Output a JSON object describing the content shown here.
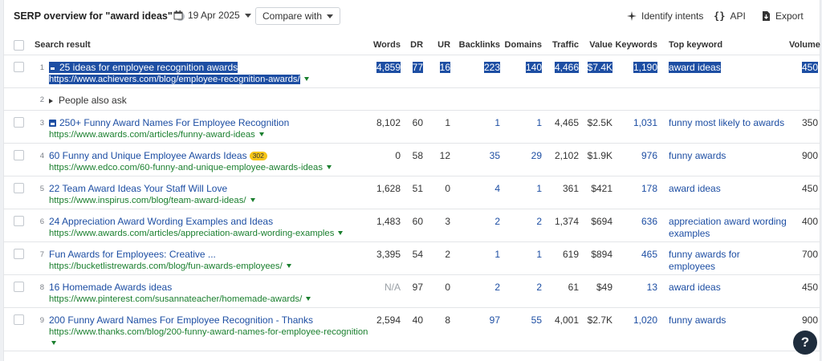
{
  "header": {
    "title": "SERP overview for \"award ideas\"",
    "help_icon": "question-icon",
    "date": "19 Apr 2025",
    "compare_label": "Compare with",
    "identify_label": "Identify intents",
    "api_label": "API",
    "export_label": "Export"
  },
  "columns": {
    "search_result": "Search result",
    "words": "Words",
    "dr": "DR",
    "ur": "UR",
    "backlinks": "Backlinks",
    "domains": "Domains",
    "traffic": "Traffic",
    "value": "Value",
    "keywords": "Keywords",
    "top_keyword": "Top keyword",
    "volume": "Volume"
  },
  "rows": [
    {
      "num": "1",
      "title": "25 ideas for employee recognition awards",
      "url": "https://www.achievers.com/blog/employee-recognition-awards/",
      "words": "4,859",
      "dr": "77",
      "ur": "16",
      "backlinks": "223",
      "domains": "140",
      "traffic": "4,466",
      "value": "$7.4K",
      "keywords": "1,190",
      "top_keyword": "award ideas",
      "volume": "450"
    },
    {
      "num": "2",
      "paa": "People also ask"
    },
    {
      "num": "3",
      "title": "250+ Funny Award Names For Employee Recognition",
      "url": "https://www.awards.com/articles/funny-award-ideas",
      "words": "8,102",
      "dr": "60",
      "ur": "1",
      "backlinks": "1",
      "domains": "1",
      "traffic": "4,465",
      "value": "$2.5K",
      "keywords": "1,031",
      "top_keyword": "funny most likely to awards",
      "volume": "350"
    },
    {
      "num": "4",
      "title": "60 Funny and Unique Employee Awards Ideas",
      "badge": "302",
      "url": "https://www.edco.com/60-funny-and-unique-employee-awards-ideas",
      "words": "0",
      "dr": "58",
      "ur": "12",
      "backlinks": "35",
      "domains": "29",
      "traffic": "2,102",
      "value": "$1.9K",
      "keywords": "976",
      "top_keyword": "funny awards",
      "volume": "900"
    },
    {
      "num": "5",
      "title": "22 Team Award Ideas Your Staff Will Love",
      "url": "https://www.inspirus.com/blog/team-award-ideas/",
      "words": "1,628",
      "dr": "51",
      "ur": "0",
      "backlinks": "4",
      "domains": "1",
      "traffic": "361",
      "value": "$421",
      "keywords": "178",
      "top_keyword": "award ideas",
      "volume": "450"
    },
    {
      "num": "6",
      "title": "24 Appreciation Award Wording Examples and Ideas",
      "url": "https://www.awards.com/articles/appreciation-award-wording-examples",
      "words": "1,483",
      "dr": "60",
      "ur": "3",
      "backlinks": "2",
      "domains": "2",
      "traffic": "1,374",
      "value": "$694",
      "keywords": "636",
      "top_keyword_l1": "appreciation award wording",
      "top_keyword_l2": "examples",
      "volume": "400"
    },
    {
      "num": "7",
      "title": "Fun Awards for Employees: Creative ...",
      "url": "https://bucketlistrewards.com/blog/fun-awards-employees/",
      "words": "3,395",
      "dr": "54",
      "ur": "2",
      "backlinks": "1",
      "domains": "1",
      "traffic": "619",
      "value": "$894",
      "keywords": "465",
      "top_keyword_l1": "funny awards for",
      "top_keyword_l2": "employees",
      "volume": "700"
    },
    {
      "num": "8",
      "title": "16 Homemade Awards ideas",
      "url": "https://www.pinterest.com/susannateacher/homemade-awards/",
      "words": "N/A",
      "dr": "97",
      "ur": "0",
      "backlinks": "2",
      "domains": "2",
      "traffic": "61",
      "value": "$49",
      "keywords": "13",
      "top_keyword": "award ideas",
      "volume": "450"
    },
    {
      "num": "9",
      "title": "200 Funny Award Names For Employee Recognition - Thanks",
      "url": "https://www.thanks.com/blog/200-funny-award-names-for-employee-recognition",
      "words": "2,594",
      "dr": "40",
      "ur": "8",
      "backlinks": "97",
      "domains": "55",
      "traffic": "4,001",
      "value": "$2.7K",
      "keywords": "1,020",
      "top_keyword": "funny awards",
      "volume": "900"
    }
  ],
  "help_fab": "?"
}
